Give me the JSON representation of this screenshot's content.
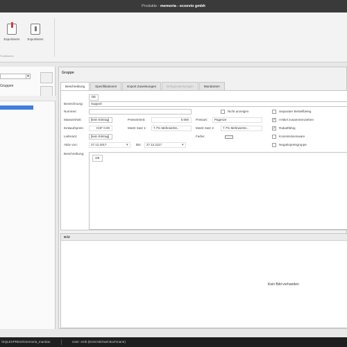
{
  "window": {
    "title_prefix": "Produkte - ",
    "title_bold": "memoria - ecoevio gmbh"
  },
  "ribbon": {
    "buttons": [
      {
        "label": "Exportieren",
        "icon": "export-icon"
      },
      {
        "label": "Exportieren",
        "icon": "import-icon"
      }
    ],
    "group_label": "Funktionen"
  },
  "left": {
    "combo_arrow": "▾",
    "label": "Gruppen"
  },
  "main": {
    "title": "Gruppe",
    "tabs": [
      {
        "label": "Beschreibung",
        "state": "active"
      },
      {
        "label": "Spezifikationen",
        "state": "normal"
      },
      {
        "label": "Export Zuweisungen",
        "state": "normal"
      },
      {
        "label": "Belegzuweisungen",
        "state": "disabled"
      },
      {
        "label": "Mandanten",
        "state": "normal"
      }
    ],
    "form": {
      "lang_tag": "DE",
      "bezeichnung_label": "Bezeichnung:",
      "bezeichnung_value": "Support",
      "nummer_label": "Nummer:",
      "nummer_value": "",
      "nicht_anzeigen_label": "Nicht anzeigen",
      "nicht_anzeigen_checked": false,
      "separater_beleg_label": "Separater Bestellbeleg",
      "separater_beleg_checked": false,
      "masseinheit_label": "Masseinheit:",
      "masseinheit_value": "[kein Eintrag]",
      "preiseinheit_label": "Preiseinheit:",
      "preiseinheit_value": "0.000",
      "preisart_label": "Preisart:",
      "preisart_value": "Pagesze",
      "artikel_zusammen_label": "Artikel zusammenziehen",
      "artikel_zusammen_checked": true,
      "einkaufspreis_label": "Einkaufspreis:",
      "einkaufspreis_value": "CHF 0.00",
      "mwst1_label": "MwSt Satz 1:",
      "mwst1_value": "7.7% Mehrwertst...",
      "mwst2_label": "MwSt Satz 2:",
      "mwst2_value": "7.7% Mehrwertst...",
      "rabattfaehig_label": "Rabattfähig",
      "rabattfaehig_checked": true,
      "lieferant_label": "Lieferant:",
      "lieferant_value": "[kein Eintrag]",
      "farbe_label": "Farbe:",
      "farbe_color": "#f4f4f4",
      "kommissionsware_label": "Kommissionsware",
      "kommissionsware_checked": false,
      "aktiv_von_label": "Aktiv von:",
      "aktiv_von_value": "27.12.2017",
      "bis_label": "Bis:",
      "bis_value": "27.12.2117",
      "negativpreis_label": "Negativpreisgruppe",
      "negativpreis_checked": false,
      "beschreibung_label": "Beschreibung:",
      "beschreibung_lang": "DE",
      "dropdown_arrow": "▾",
      "check_mark": "✓"
    },
    "bild": {
      "title": "Bild",
      "empty_text": "Kein Bild vorhanden"
    }
  },
  "statusbar": {
    "connection": "\\SQLEXPRESS\\memoria_mandan",
    "user": "User: ernb (Ernst Michael Buchmann)"
  },
  "colors": {
    "selection": "#3e7fe0",
    "titlebar": "#3a3a3a",
    "statusbar": "#1f1f1f"
  }
}
